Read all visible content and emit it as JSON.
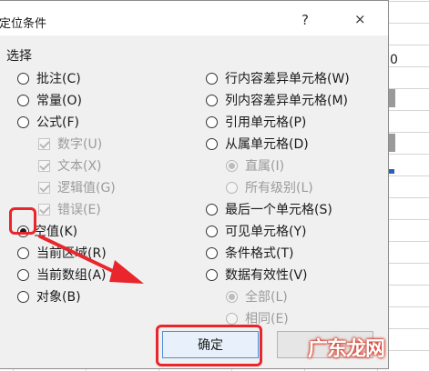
{
  "dialog": {
    "title": "定位条件",
    "help_icon": "?",
    "close_icon": "×",
    "group_label": "选择"
  },
  "left_options": [
    {
      "label": "批注(C)",
      "kind": "radio",
      "selected": false,
      "enabled": true
    },
    {
      "label": "常量(O)",
      "kind": "radio",
      "selected": false,
      "enabled": true
    },
    {
      "label": "公式(F)",
      "kind": "radio",
      "selected": false,
      "enabled": true
    },
    {
      "label": "数字(U)",
      "kind": "checkbox",
      "checked": true,
      "enabled": false
    },
    {
      "label": "文本(X)",
      "kind": "checkbox",
      "checked": true,
      "enabled": false
    },
    {
      "label": "逻辑值(G)",
      "kind": "checkbox",
      "checked": true,
      "enabled": false
    },
    {
      "label": "错误(E)",
      "kind": "checkbox",
      "checked": true,
      "enabled": false
    },
    {
      "label": "空值(K)",
      "kind": "radio",
      "selected": true,
      "enabled": true
    },
    {
      "label": "当前区域(R)",
      "kind": "radio",
      "selected": false,
      "enabled": true
    },
    {
      "label": "当前数组(A)",
      "kind": "radio",
      "selected": false,
      "enabled": true
    },
    {
      "label": "对象(B)",
      "kind": "radio",
      "selected": false,
      "enabled": true
    }
  ],
  "right_options": [
    {
      "label": "行内容差异单元格(W)",
      "kind": "radio",
      "selected": false,
      "enabled": true
    },
    {
      "label": "列内容差异单元格(M)",
      "kind": "radio",
      "selected": false,
      "enabled": true
    },
    {
      "label": "引用单元格(P)",
      "kind": "radio",
      "selected": false,
      "enabled": true
    },
    {
      "label": "从属单元格(D)",
      "kind": "radio",
      "selected": false,
      "enabled": true
    },
    {
      "label": "直属(I)",
      "kind": "radio",
      "selected": true,
      "enabled": false
    },
    {
      "label": "所有级别(L)",
      "kind": "radio",
      "selected": false,
      "enabled": false
    },
    {
      "label": "最后一个单元格(S)",
      "kind": "radio",
      "selected": false,
      "enabled": true
    },
    {
      "label": "可见单元格(Y)",
      "kind": "radio",
      "selected": false,
      "enabled": true
    },
    {
      "label": "条件格式(T)",
      "kind": "radio",
      "selected": false,
      "enabled": true
    },
    {
      "label": "数据有效性(V)",
      "kind": "radio",
      "selected": false,
      "enabled": true
    },
    {
      "label": "全部(L)",
      "kind": "radio",
      "selected": true,
      "enabled": false
    },
    {
      "label": "相同(E)",
      "kind": "radio",
      "selected": false,
      "enabled": false
    }
  ],
  "buttons": {
    "ok_label": "确定",
    "cancel_label": ""
  },
  "sheet": {
    "edge_text": "0"
  },
  "watermark": "广东龙网",
  "colors": {
    "highlight": "#e8262b",
    "dialog_bg": "#f0f0f0",
    "ok_button_bg": "#e8f1fb",
    "ok_button_border": "#4a8fd8"
  }
}
